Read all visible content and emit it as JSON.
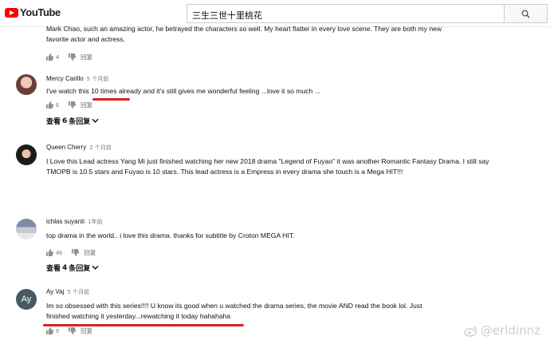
{
  "header": {
    "logo_text": "YouTube",
    "search_value": "三生三世十里桃花"
  },
  "comments": [
    {
      "text_line1": "Mark Chao, such an amazing actor, he betrayed the characters so well.  My heart flatter in every love scene.  They are both my new",
      "text_line2": "favorite actor and actress.",
      "likes": "4",
      "reply_label": "回复"
    },
    {
      "author": "Mercy Carillo",
      "time": "5 个月前",
      "text_pre": "I've watch this ",
      "text_hl": "10 times",
      "text_post": " already and it's still gives me wonderful feeling ...love it so much ...",
      "likes": "6",
      "reply_label": "回复",
      "view_prefix": "查看",
      "view_count": "6",
      "view_suffix": "条回复"
    },
    {
      "author": "Queen Cherry",
      "time": "2 个月前",
      "text": "I Love this Lead actress Yang Mi just finished watching her new 2018 drama \"Legend of Fuyao\" it was another Romantic Fantasy Drama. I still say TMOPB is 10.5 stars and Fuyao is 10 stars. This lead actress is a Empress in every drama she touch is a Mega HIT!!!",
      "likes": "5",
      "reply_label": "回复"
    },
    {
      "author": "ichlas suyanti",
      "time": "1年前",
      "text": "top drama in the world.. i love this drama. thanks for subtitle by Croton MEGA HIT.",
      "likes": "46",
      "reply_label": "回复",
      "view_prefix": "查看",
      "view_count": "4",
      "view_suffix": "条回复"
    },
    {
      "author": "Ay Vaj",
      "time": "5 个月前",
      "avatar_initials": "Ay",
      "text_line1": "Im so obsessed with this series!!!! U know its good when u watched the drama series, the movie AND read the book lol. Just",
      "text_line2": "finished watching it yesterday...rewatching it today hahahaha",
      "likes": "6",
      "reply_label": "回复"
    }
  ],
  "watermark": "@erldinnz",
  "colors": {
    "youtube_red": "#ff0000",
    "annotation_red": "#d92323",
    "avatar_teal": "#455a64"
  }
}
